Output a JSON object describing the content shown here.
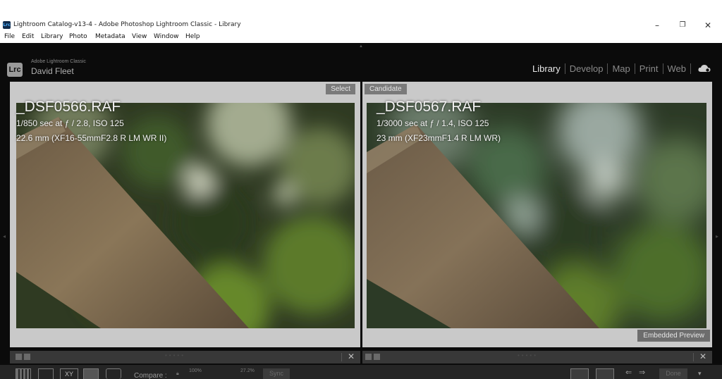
{
  "window": {
    "app_icon": "Lrc",
    "title": "Lightroom Catalog-v13-4 - Adobe Photoshop Lightroom Classic - Library",
    "minimize": "–",
    "maximize": "❐",
    "close": "✕"
  },
  "menu": [
    "File",
    "Edit",
    "Library",
    "Photo",
    "Metadata",
    "View",
    "Window",
    "Help"
  ],
  "identity": {
    "logo": "Lrc",
    "product": "Adobe Lightroom Classic",
    "user": "David Fleet"
  },
  "modules": {
    "items": [
      "Library",
      "Develop",
      "Map",
      "Print",
      "Web"
    ],
    "active": "Library",
    "cloud_icon": "cloud-sync-icon"
  },
  "compare": {
    "select": {
      "tag": "Select",
      "filename": "_DSF0566.RAF",
      "exposure": "1/850 sec at ƒ / 2.8, ISO 125",
      "lens": "22.6 mm (XF16-55mmF2.8 R LM WR II)"
    },
    "candidate": {
      "tag": "Candidate",
      "filename": "_DSF0567.RAF",
      "exposure": "1/3000 sec at ƒ / 1.4, ISO 125",
      "lens": "23 mm (XF23mmF1.4 R LM WR)"
    },
    "preview_badge": "Embedded Preview"
  },
  "toolbar": {
    "view_icons": [
      "grid-view-icon",
      "loupe-view-icon",
      "compare-view-icon",
      "survey-view-icon",
      "people-view-icon"
    ],
    "compare_label": "Compare :",
    "zoom_left": "100%",
    "zoom_right": "27.2%",
    "sync_label": "Sync",
    "swap_icons": [
      "swap-icon",
      "make-select-icon"
    ],
    "done_label": "Done"
  },
  "colors": {
    "app_bg": "#0b0b0b",
    "pane_bg": "#c9c9c9",
    "active_module": "#e8e8e8",
    "inactive_module": "#8a8a8a"
  }
}
